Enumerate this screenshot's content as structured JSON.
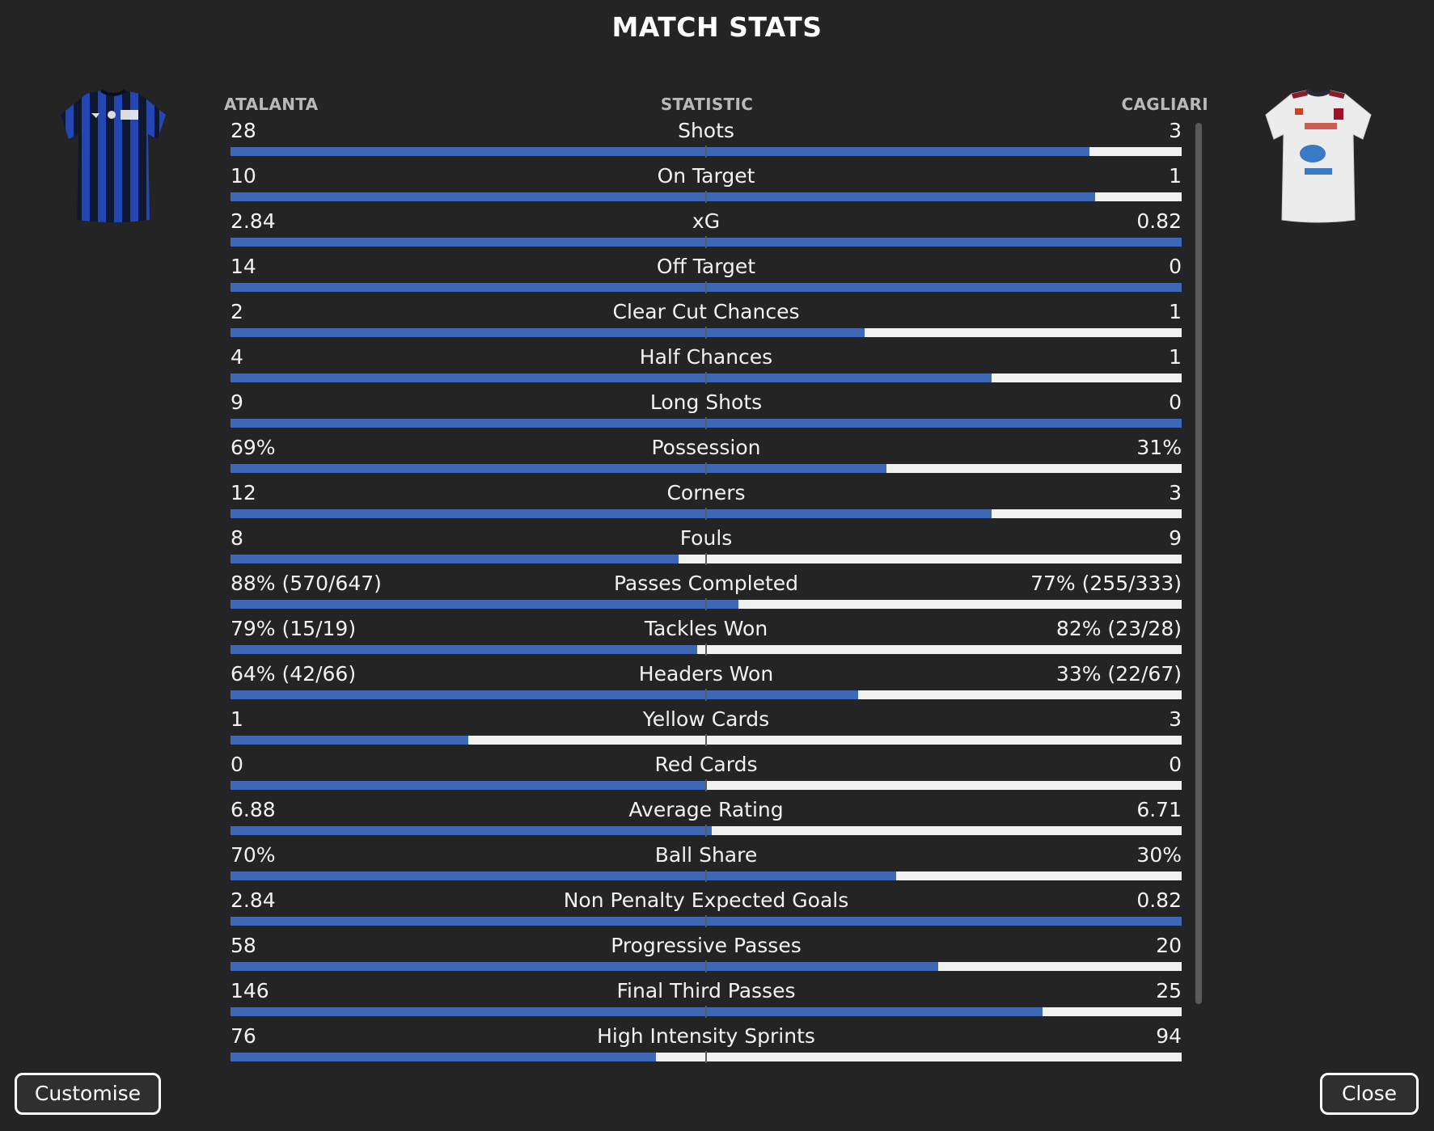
{
  "title": "MATCH STATS",
  "colors": {
    "background": "#242424",
    "home_bar": "#3e67b6",
    "away_bar": "#f1f1f1"
  },
  "headers": {
    "home": "ATALANTA",
    "statistic": "STATISTIC",
    "away": "CAGLIARI"
  },
  "kits": {
    "home": "atalanta-kit-icon",
    "away": "cagliari-kit-icon"
  },
  "stats": [
    {
      "label": "Shots",
      "home": "28",
      "away": "3",
      "home_share": 0.903
    },
    {
      "label": "On Target",
      "home": "10",
      "away": "1",
      "home_share": 0.909
    },
    {
      "label": "xG",
      "home": "2.84",
      "away": "0.82",
      "home_share": 1.0
    },
    {
      "label": "Off Target",
      "home": "14",
      "away": "0",
      "home_share": 1.0
    },
    {
      "label": "Clear Cut Chances",
      "home": "2",
      "away": "1",
      "home_share": 0.667
    },
    {
      "label": "Half Chances",
      "home": "4",
      "away": "1",
      "home_share": 0.8
    },
    {
      "label": "Long Shots",
      "home": "9",
      "away": "0",
      "home_share": 1.0
    },
    {
      "label": "Possession",
      "home": "69%",
      "away": "31%",
      "home_share": 0.69
    },
    {
      "label": "Corners",
      "home": "12",
      "away": "3",
      "home_share": 0.8
    },
    {
      "label": "Fouls",
      "home": "8",
      "away": "9",
      "home_share": 0.471
    },
    {
      "label": "Passes Completed",
      "home": "88% (570/647)",
      "away": "77% (255/333)",
      "home_share": 0.534
    },
    {
      "label": "Tackles Won",
      "home": "79% (15/19)",
      "away": "82% (23/28)",
      "home_share": 0.491
    },
    {
      "label": "Headers Won",
      "home": "64% (42/66)",
      "away": "33% (22/67)",
      "home_share": 0.66
    },
    {
      "label": "Yellow Cards",
      "home": "1",
      "away": "3",
      "home_share": 0.25
    },
    {
      "label": "Red Cards",
      "home": "0",
      "away": "0",
      "home_share": 0.5
    },
    {
      "label": "Average Rating",
      "home": "6.88",
      "away": "6.71",
      "home_share": 0.506
    },
    {
      "label": "Ball Share",
      "home": "70%",
      "away": "30%",
      "home_share": 0.7
    },
    {
      "label": "Non Penalty Expected Goals",
      "home": "2.84",
      "away": "0.82",
      "home_share": 1.0
    },
    {
      "label": "Progressive Passes",
      "home": "58",
      "away": "20",
      "home_share": 0.744
    },
    {
      "label": "Final Third Passes",
      "home": "146",
      "away": "25",
      "home_share": 0.854
    },
    {
      "label": "High Intensity Sprints",
      "home": "76",
      "away": "94",
      "home_share": 0.447
    }
  ],
  "buttons": {
    "customise": "Customise",
    "close": "Close"
  }
}
